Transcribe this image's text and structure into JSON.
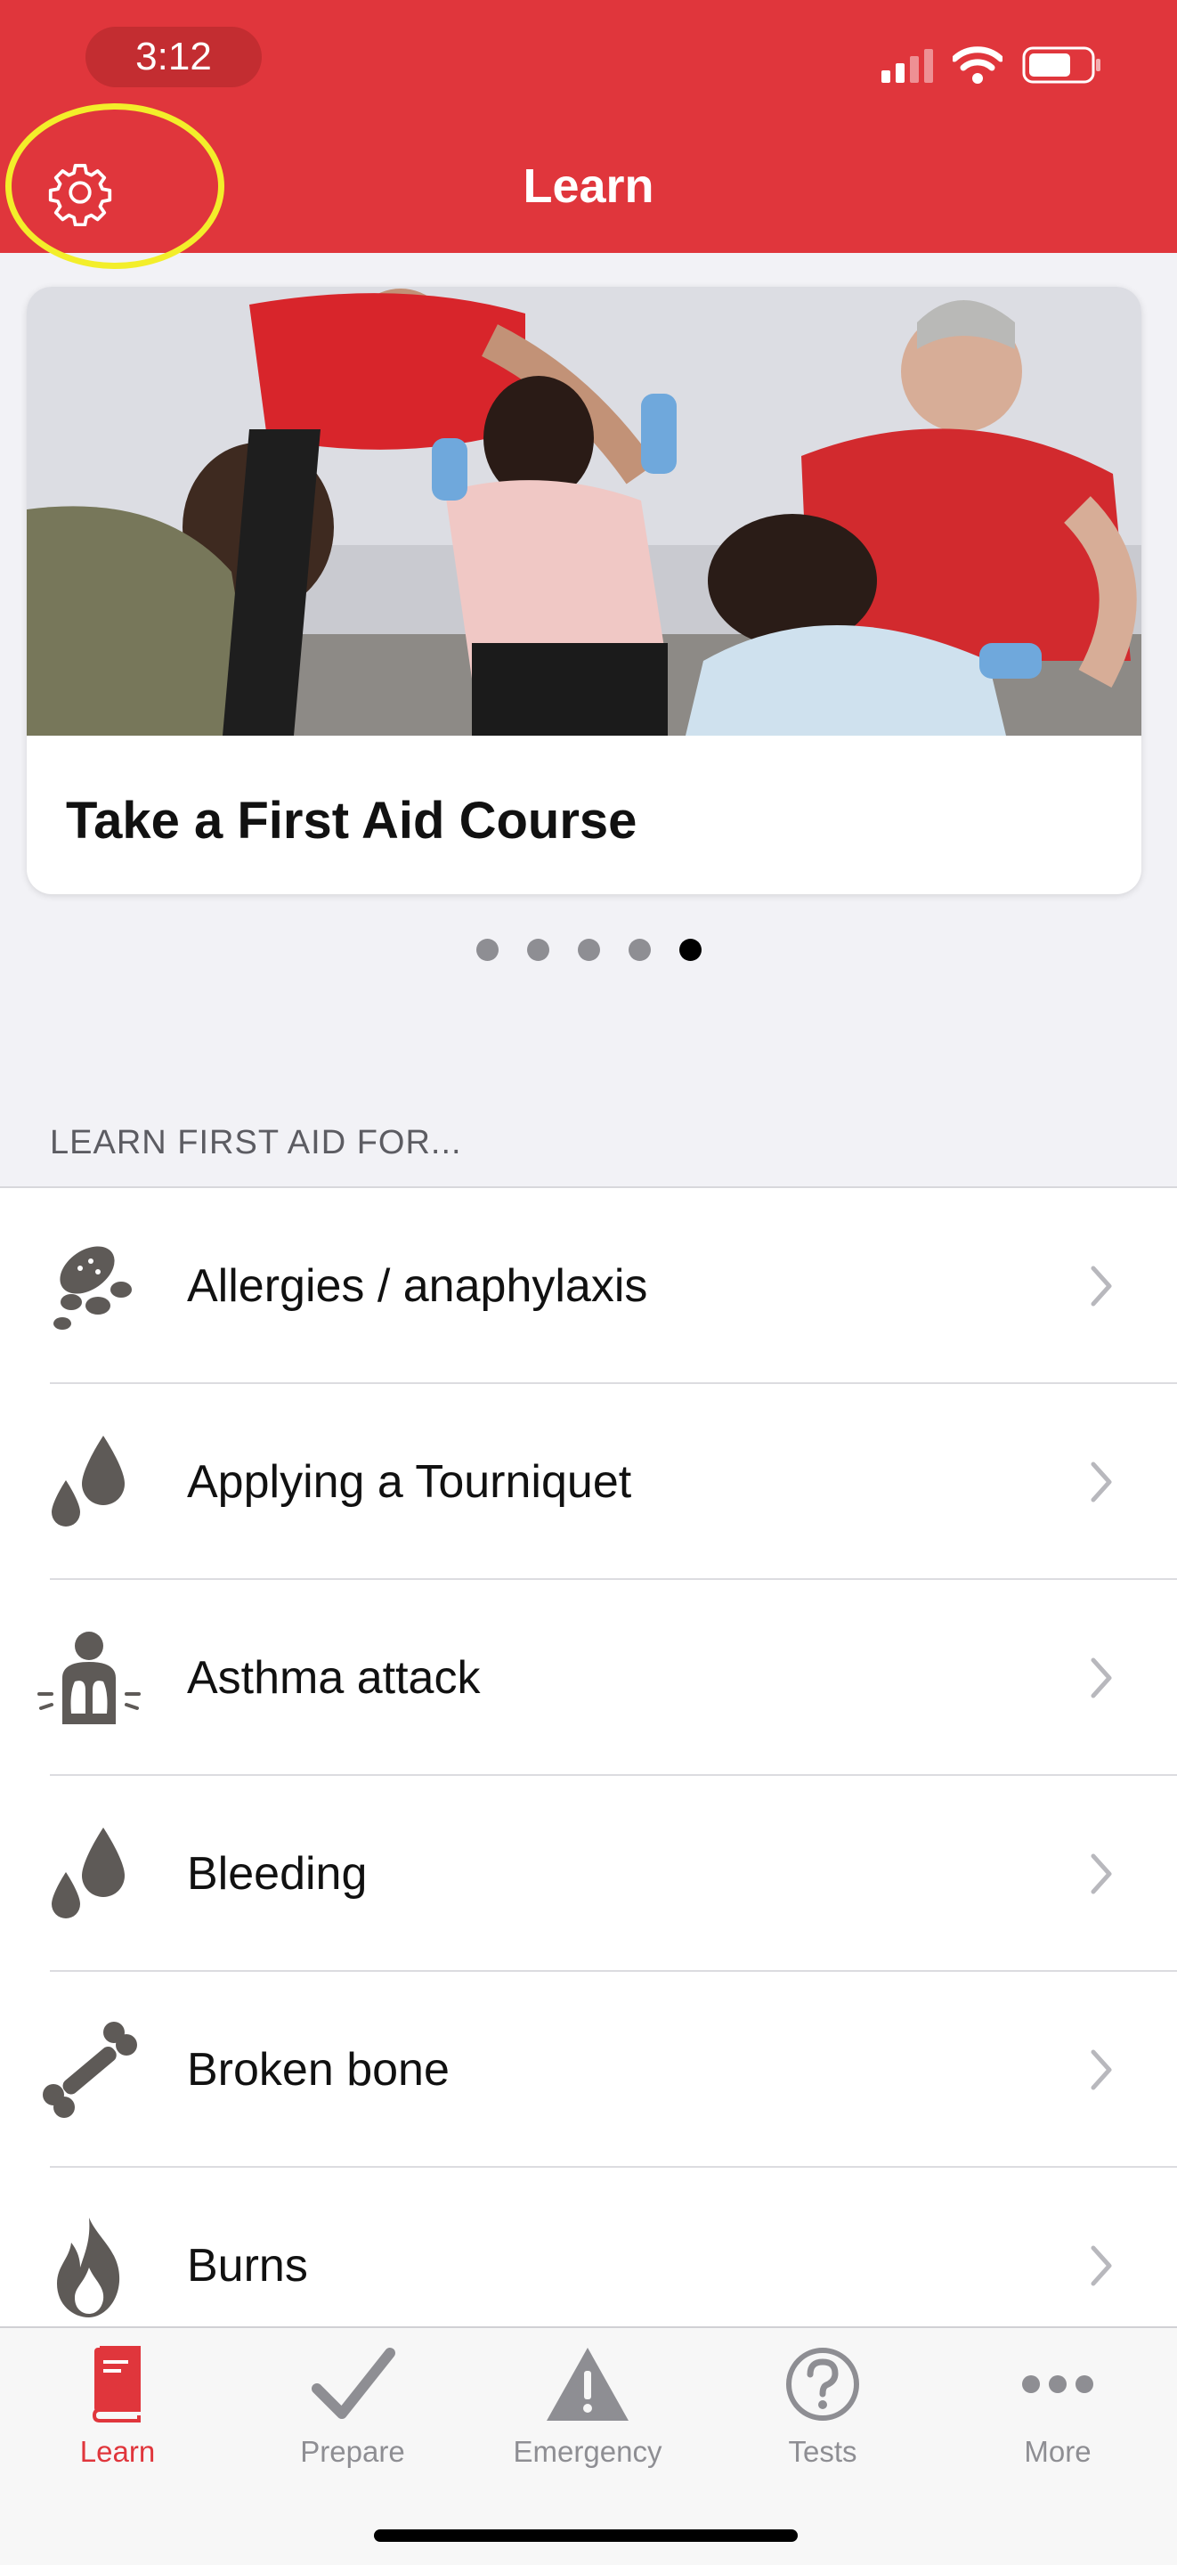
{
  "status_bar": {
    "time": "3:12"
  },
  "header": {
    "title": "Learn",
    "settings_icon": "gear-icon"
  },
  "colors": {
    "brand_red": "#e0363c",
    "highlight_ring": "#f3ee2a"
  },
  "carousel": {
    "card_title": "Take a First Aid Course",
    "page_count": 5,
    "active_page": 5
  },
  "section": {
    "header": "LEARN FIRST AID FOR..."
  },
  "list": {
    "items": [
      {
        "label": "Allergies / anaphylaxis",
        "icon": "peanut-icon"
      },
      {
        "label": "Applying a Tourniquet",
        "icon": "blood-drops-icon"
      },
      {
        "label": "Asthma attack",
        "icon": "lungs-icon"
      },
      {
        "label": "Bleeding",
        "icon": "blood-drops-icon"
      },
      {
        "label": "Broken bone",
        "icon": "bone-icon"
      },
      {
        "label": "Burns",
        "icon": "flame-icon"
      }
    ]
  },
  "tabbar": {
    "tabs": [
      {
        "label": "Learn",
        "icon": "book-icon",
        "active": true
      },
      {
        "label": "Prepare",
        "icon": "checkmark-icon",
        "active": false
      },
      {
        "label": "Emergency",
        "icon": "warning-icon",
        "active": false
      },
      {
        "label": "Tests",
        "icon": "question-icon",
        "active": false
      },
      {
        "label": "More",
        "icon": "more-dots-icon",
        "active": false
      }
    ]
  }
}
